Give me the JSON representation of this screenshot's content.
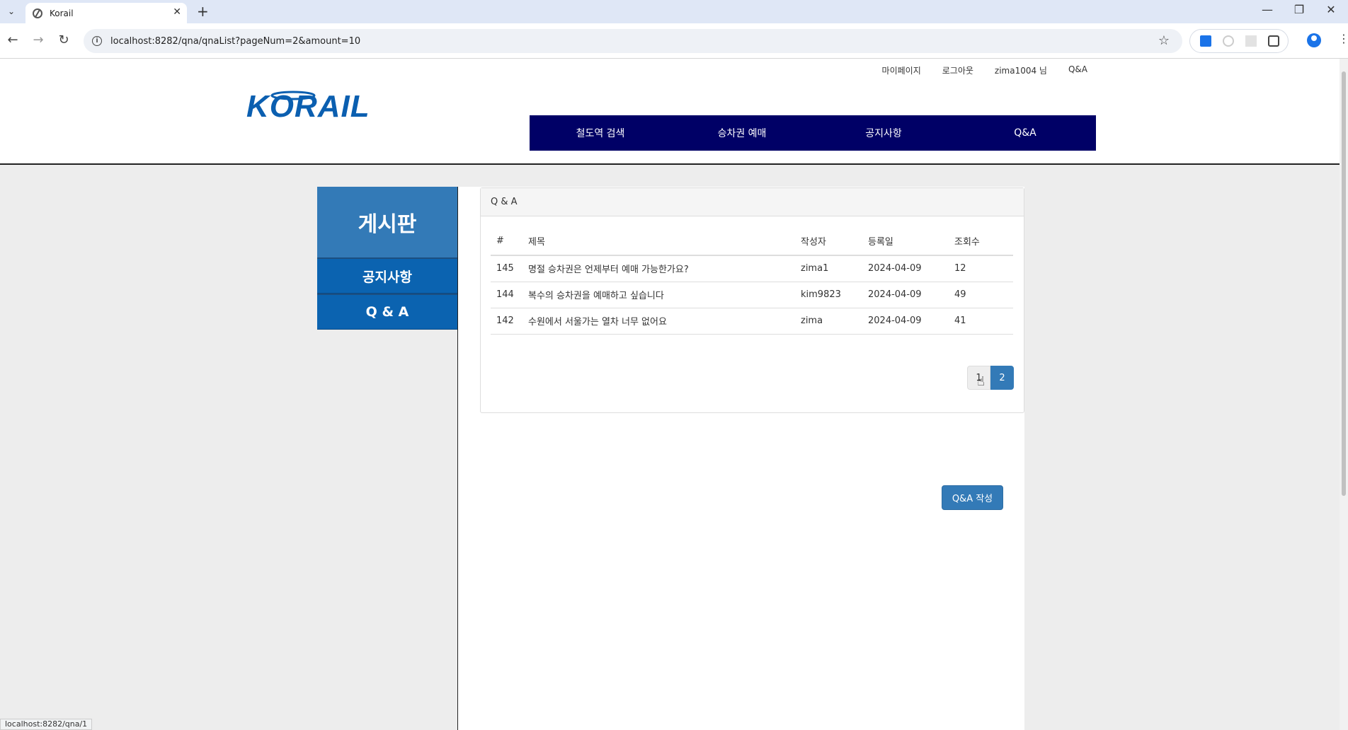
{
  "browser": {
    "tab_title": "Korail",
    "url": "localhost:8282/qna/qnaList?pageNum=2&amount=10",
    "status_url": "localhost:8282/qna/1"
  },
  "header": {
    "util_links": [
      "마이페이지",
      "로그아웃",
      "zima1004 님",
      "Q&A"
    ],
    "logo_text": "KORAIL",
    "nav": [
      "철도역 검색",
      "승차권 예매",
      "공지사항",
      "Q&A"
    ]
  },
  "sidebar": {
    "title": "게시판",
    "items": [
      "공지사항",
      "Q & A"
    ]
  },
  "panel": {
    "heading": "Q & A",
    "columns": [
      "#",
      "제목",
      "작성자",
      "등록일",
      "조회수"
    ],
    "rows": [
      {
        "no": "145",
        "title": "명절 승차권은 언제부터 예매 가능한가요?",
        "writer": "zima1",
        "date": "2024-04-09",
        "views": "12"
      },
      {
        "no": "144",
        "title": "복수의 승차권을 예매하고 싶습니다",
        "writer": "kim9823",
        "date": "2024-04-09",
        "views": "49"
      },
      {
        "no": "142",
        "title": "수원에서 서울가는 열차 너무 없어요",
        "writer": "zima",
        "date": "2024-04-09",
        "views": "41"
      }
    ],
    "pages": [
      "1",
      "2"
    ],
    "current_page": "2"
  },
  "write_button": "Q&A 작성",
  "colors": {
    "nav_bg": "#000066",
    "primary": "#337ab7",
    "sidebar_item_bg": "#0b63b0"
  }
}
